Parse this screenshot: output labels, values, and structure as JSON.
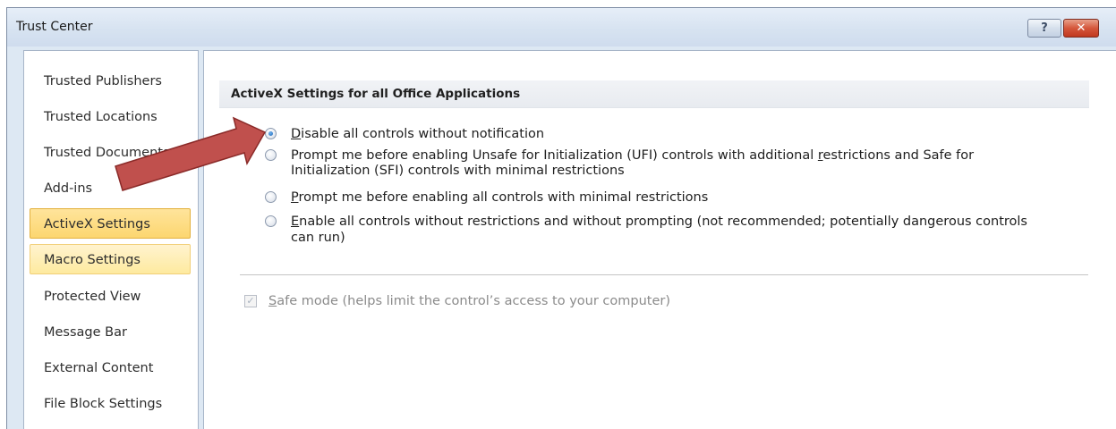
{
  "window": {
    "title": "Trust Center",
    "help_label": "?",
    "close_label": "✕"
  },
  "sidebar": {
    "items": [
      {
        "label": "Trusted Publishers"
      },
      {
        "label": "Trusted Locations"
      },
      {
        "label": "Trusted Documents"
      },
      {
        "label": "Add-ins"
      },
      {
        "label": "ActiveX Settings"
      },
      {
        "label": "Macro Settings"
      },
      {
        "label": "Protected View"
      },
      {
        "label": "Message Bar"
      },
      {
        "label": "External Content"
      },
      {
        "label": "File Block Settings"
      }
    ],
    "selected": "ActiveX Settings",
    "hovered": "Macro Settings"
  },
  "activex": {
    "header": "ActiveX Settings for all Office Applications",
    "options": [
      {
        "key": "D",
        "rest": "isable all controls without notification",
        "line2": "",
        "checked": true
      },
      {
        "pre": "Prompt me before enabling Unsafe for Initialization (UFI) controls with additional ",
        "key": "r",
        "rest": "estrictions and Safe for",
        "line2": "Initialization (SFI) controls with minimal restrictions",
        "checked": false
      },
      {
        "key": "P",
        "rest": "rompt me before enabling all controls with minimal restrictions",
        "line2": "",
        "checked": false
      },
      {
        "key": "E",
        "rest": "nable all controls without restrictions and without prompting (not recommended; potentially dangerous controls",
        "line2": "can run)",
        "checked": false
      }
    ],
    "safe_mode": {
      "key": "S",
      "rest": "afe mode (helps limit the control’s access to your computer)",
      "checked": true,
      "enabled": false
    }
  },
  "annotation": {
    "arrow_color": "#c0504d",
    "arrow_outline": "#8a2a28"
  }
}
